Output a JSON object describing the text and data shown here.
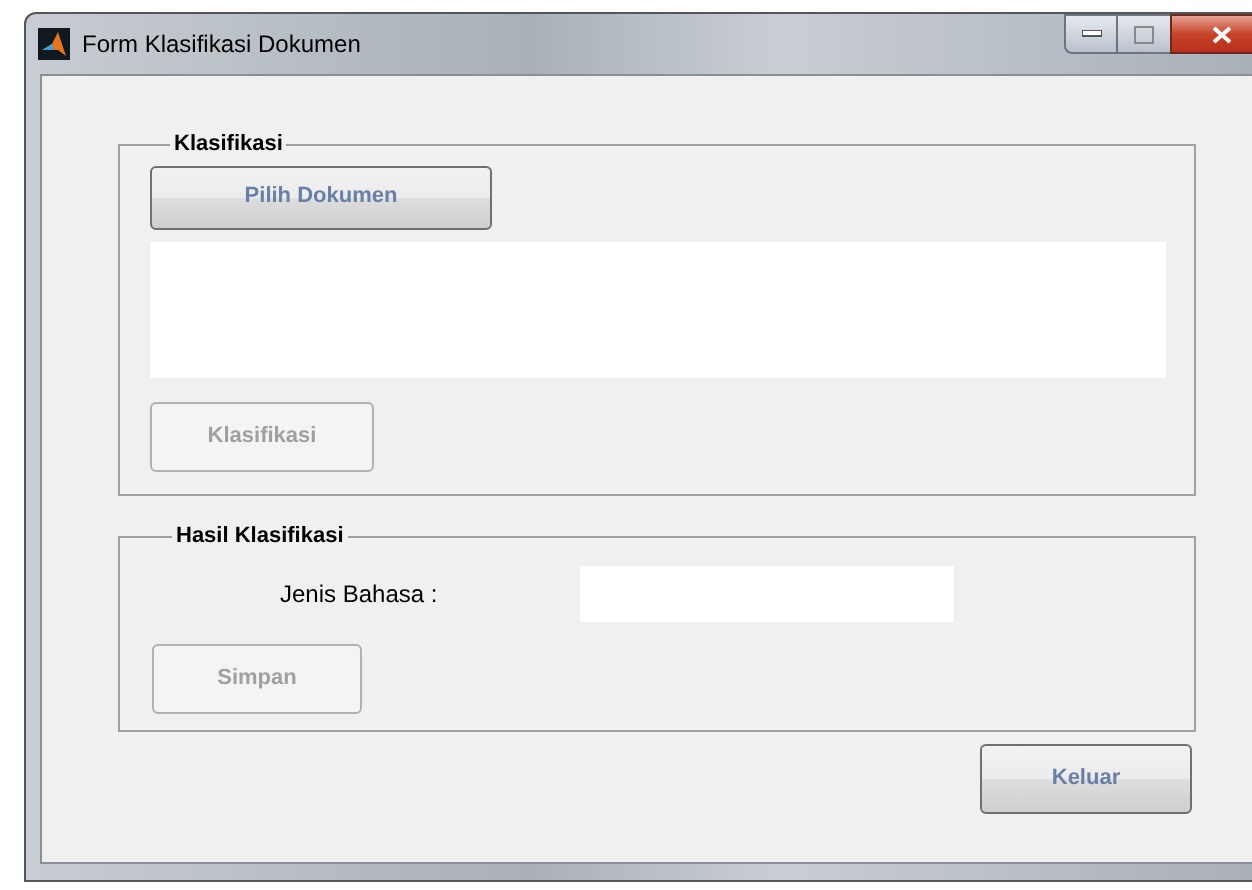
{
  "window": {
    "title": "Form Klasifikasi Dokumen"
  },
  "klasifikasi_panel": {
    "title": "Klasifikasi",
    "choose_button": {
      "label": "Pilih Dokumen",
      "disabled": false
    },
    "classify_button": {
      "label": "Klasifikasi",
      "disabled": true
    }
  },
  "hasil_panel": {
    "title": "Hasil Klasifikasi",
    "language_label": "Jenis Bahasa :",
    "save_button": {
      "label": "Simpan",
      "disabled": true
    }
  },
  "exit_button": {
    "label": "Keluar",
    "disabled": false
  }
}
